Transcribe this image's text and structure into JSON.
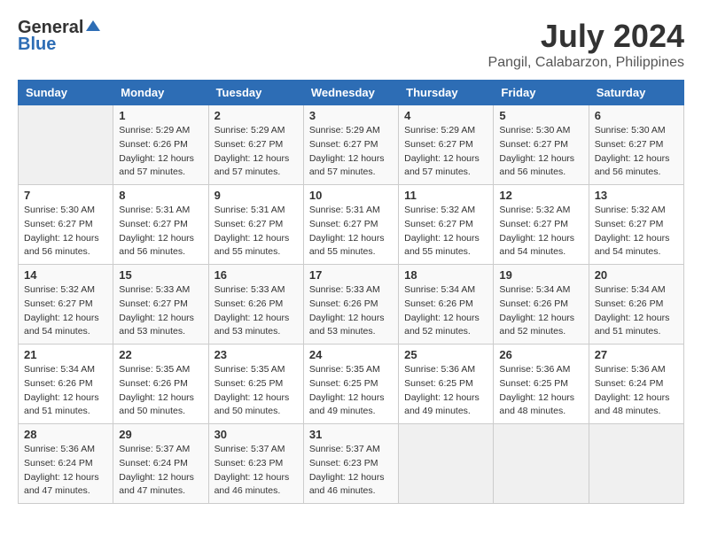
{
  "header": {
    "logo_general": "General",
    "logo_blue": "Blue",
    "month": "July 2024",
    "location": "Pangil, Calabarzon, Philippines"
  },
  "days_of_week": [
    "Sunday",
    "Monday",
    "Tuesday",
    "Wednesday",
    "Thursday",
    "Friday",
    "Saturday"
  ],
  "weeks": [
    [
      {
        "day": "",
        "info": ""
      },
      {
        "day": "1",
        "info": "Sunrise: 5:29 AM\nSunset: 6:26 PM\nDaylight: 12 hours\nand 57 minutes."
      },
      {
        "day": "2",
        "info": "Sunrise: 5:29 AM\nSunset: 6:27 PM\nDaylight: 12 hours\nand 57 minutes."
      },
      {
        "day": "3",
        "info": "Sunrise: 5:29 AM\nSunset: 6:27 PM\nDaylight: 12 hours\nand 57 minutes."
      },
      {
        "day": "4",
        "info": "Sunrise: 5:29 AM\nSunset: 6:27 PM\nDaylight: 12 hours\nand 57 minutes."
      },
      {
        "day": "5",
        "info": "Sunrise: 5:30 AM\nSunset: 6:27 PM\nDaylight: 12 hours\nand 56 minutes."
      },
      {
        "day": "6",
        "info": "Sunrise: 5:30 AM\nSunset: 6:27 PM\nDaylight: 12 hours\nand 56 minutes."
      }
    ],
    [
      {
        "day": "7",
        "info": ""
      },
      {
        "day": "8",
        "info": "Sunrise: 5:31 AM\nSunset: 6:27 PM\nDaylight: 12 hours\nand 56 minutes."
      },
      {
        "day": "9",
        "info": "Sunrise: 5:31 AM\nSunset: 6:27 PM\nDaylight: 12 hours\nand 55 minutes."
      },
      {
        "day": "10",
        "info": "Sunrise: 5:31 AM\nSunset: 6:27 PM\nDaylight: 12 hours\nand 55 minutes."
      },
      {
        "day": "11",
        "info": "Sunrise: 5:32 AM\nSunset: 6:27 PM\nDaylight: 12 hours\nand 55 minutes."
      },
      {
        "day": "12",
        "info": "Sunrise: 5:32 AM\nSunset: 6:27 PM\nDaylight: 12 hours\nand 54 minutes."
      },
      {
        "day": "13",
        "info": "Sunrise: 5:32 AM\nSunset: 6:27 PM\nDaylight: 12 hours\nand 54 minutes."
      }
    ],
    [
      {
        "day": "14",
        "info": ""
      },
      {
        "day": "15",
        "info": "Sunrise: 5:33 AM\nSunset: 6:27 PM\nDaylight: 12 hours\nand 53 minutes."
      },
      {
        "day": "16",
        "info": "Sunrise: 5:33 AM\nSunset: 6:26 PM\nDaylight: 12 hours\nand 53 minutes."
      },
      {
        "day": "17",
        "info": "Sunrise: 5:33 AM\nSunset: 6:26 PM\nDaylight: 12 hours\nand 53 minutes."
      },
      {
        "day": "18",
        "info": "Sunrise: 5:34 AM\nSunset: 6:26 PM\nDaylight: 12 hours\nand 52 minutes."
      },
      {
        "day": "19",
        "info": "Sunrise: 5:34 AM\nSunset: 6:26 PM\nDaylight: 12 hours\nand 52 minutes."
      },
      {
        "day": "20",
        "info": "Sunrise: 5:34 AM\nSunset: 6:26 PM\nDaylight: 12 hours\nand 51 minutes."
      }
    ],
    [
      {
        "day": "21",
        "info": ""
      },
      {
        "day": "22",
        "info": "Sunrise: 5:35 AM\nSunset: 6:26 PM\nDaylight: 12 hours\nand 50 minutes."
      },
      {
        "day": "23",
        "info": "Sunrise: 5:35 AM\nSunset: 6:25 PM\nDaylight: 12 hours\nand 50 minutes."
      },
      {
        "day": "24",
        "info": "Sunrise: 5:35 AM\nSunset: 6:25 PM\nDaylight: 12 hours\nand 49 minutes."
      },
      {
        "day": "25",
        "info": "Sunrise: 5:36 AM\nSunset: 6:25 PM\nDaylight: 12 hours\nand 49 minutes."
      },
      {
        "day": "26",
        "info": "Sunrise: 5:36 AM\nSunset: 6:25 PM\nDaylight: 12 hours\nand 48 minutes."
      },
      {
        "day": "27",
        "info": "Sunrise: 5:36 AM\nSunset: 6:24 PM\nDaylight: 12 hours\nand 48 minutes."
      }
    ],
    [
      {
        "day": "28",
        "info": "Sunrise: 5:36 AM\nSunset: 6:24 PM\nDaylight: 12 hours\nand 47 minutes."
      },
      {
        "day": "29",
        "info": "Sunrise: 5:37 AM\nSunset: 6:24 PM\nDaylight: 12 hours\nand 47 minutes."
      },
      {
        "day": "30",
        "info": "Sunrise: 5:37 AM\nSunset: 6:23 PM\nDaylight: 12 hours\nand 46 minutes."
      },
      {
        "day": "31",
        "info": "Sunrise: 5:37 AM\nSunset: 6:23 PM\nDaylight: 12 hours\nand 46 minutes."
      },
      {
        "day": "",
        "info": ""
      },
      {
        "day": "",
        "info": ""
      },
      {
        "day": "",
        "info": ""
      }
    ]
  ]
}
